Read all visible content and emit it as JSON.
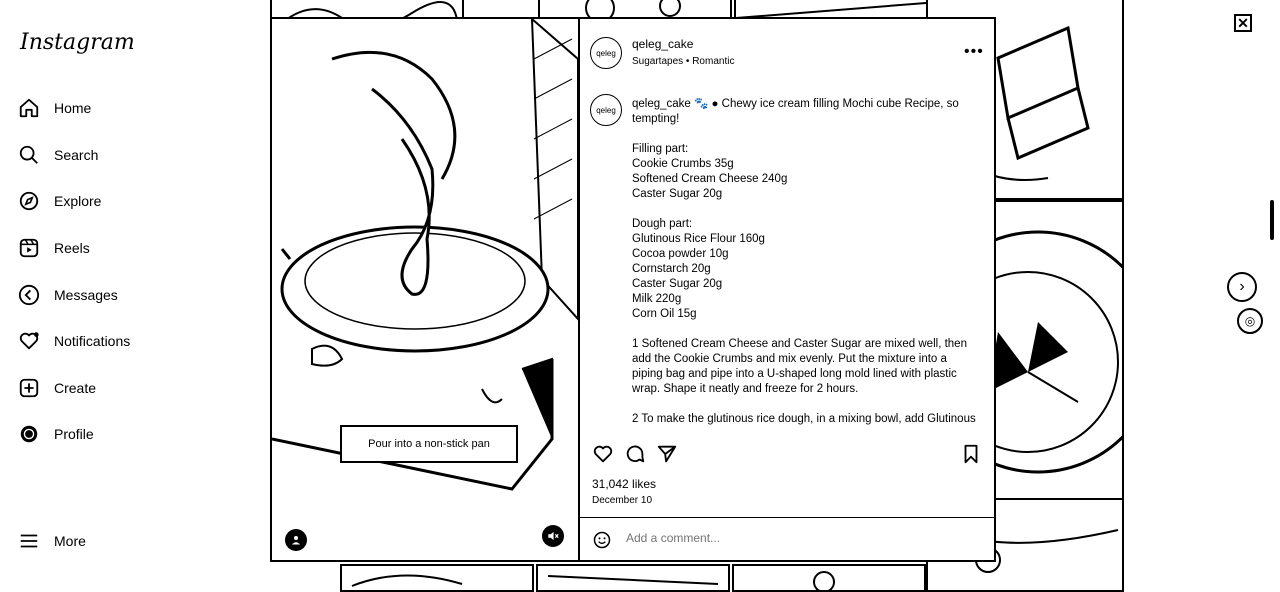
{
  "app": {
    "logo": "Instagram"
  },
  "nav": {
    "items": [
      {
        "label": "Home",
        "icon": "home-icon"
      },
      {
        "label": "Search",
        "icon": "search-icon"
      },
      {
        "label": "Explore",
        "icon": "compass-icon"
      },
      {
        "label": "Reels",
        "icon": "reels-icon"
      },
      {
        "label": "Messages",
        "icon": "messages-icon"
      },
      {
        "label": "Notifications",
        "icon": "heart-icon"
      },
      {
        "label": "Create",
        "icon": "plus-square-icon"
      },
      {
        "label": "Profile",
        "icon": "profile-icon"
      }
    ],
    "more": "More"
  },
  "post": {
    "username": "qeleg_cake",
    "audio": "Sugartapes • Romantic",
    "avatar_text": "qeleg",
    "caption_user": "qeleg_cake",
    "caption_text": "🐾 ● Chewy ice cream filling Mochi cube Recipe, so tempting!\n\nFilling part:\nCookie Crumbs 35g\nSoftened Cream Cheese 240g\nCaster Sugar 20g\n\nDough part:\nGlutinous Rice Flour 160g\nCocoa powder 10g\nCornstarch 20g\nCaster Sugar 20g\nMilk 220g\nCorn Oil 15g\n\n1 Softened Cream Cheese and Caster Sugar are mixed well, then add the Cookie Crumbs and mix evenly. Put the mixture into a piping bag and pipe into a U-shaped long mold lined with plastic wrap. Shape it neatly and freeze for 2 hours.\n\n2 To make the glutinous rice dough, in a mixing bowl, add Glutinous Rice Flour, Cocoa Powder and Caster Sugar, then add Milk",
    "media_caption": "Pour into a non-stick pan",
    "likes": "31,042 likes",
    "date": "December 10",
    "comment_placeholder": "Add a comment..."
  }
}
